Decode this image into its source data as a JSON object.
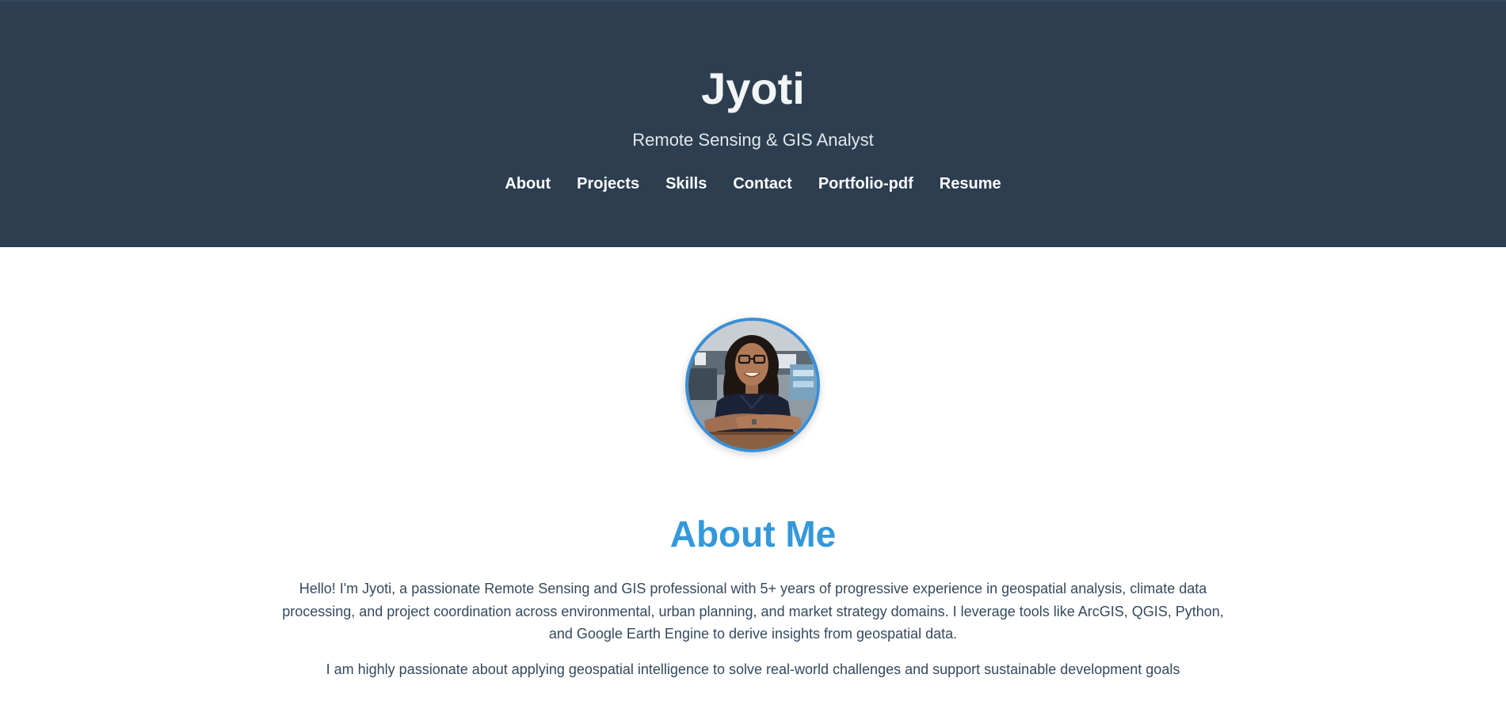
{
  "header": {
    "title": "Jyoti",
    "subtitle": "Remote Sensing & GIS Analyst",
    "nav": [
      {
        "label": "About"
      },
      {
        "label": "Projects"
      },
      {
        "label": "Skills"
      },
      {
        "label": "Contact"
      },
      {
        "label": "Portfolio-pdf"
      },
      {
        "label": "Resume"
      }
    ]
  },
  "about": {
    "heading": "About Me",
    "paragraphs": [
      "Hello! I'm Jyoti, a passionate Remote Sensing and GIS professional with 5+ years of progressive experience in geospatial analysis, climate data processing, and project coordination across environmental, urban planning, and market strategy domains. I leverage tools like ArcGIS, QGIS, Python, and Google Earth Engine to derive insights from geospatial data.",
      "I am highly passionate about applying geospatial intelligence to solve real-world challenges and support sustainable development goals"
    ]
  },
  "colors": {
    "header_bg": "#2c3e50",
    "accent": "#3498db",
    "body_text": "#34495e"
  }
}
